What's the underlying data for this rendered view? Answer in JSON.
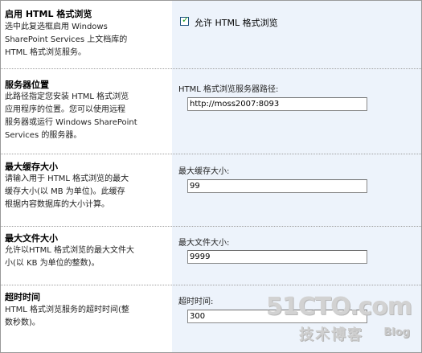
{
  "sections": [
    {
      "title": "启用 HTML 格式浏览",
      "desc": "选中此复选框启用 Windows\nSharePoint Services 上文档库的\nHTML 格式浏览服务。",
      "checkbox_label": "允许 HTML 格式浏览",
      "checked": true
    },
    {
      "title": "服务器位置",
      "desc": "此路径指定您安装 HTML 格式浏览\n应用程序的位置。您可以使用远程\n服务器或运行 Windows SharePoint\nServices 的服务器。",
      "field_label": "HTML 格式浏览服务器路径:",
      "value": "http://moss2007:8093"
    },
    {
      "title": "最大缓存大小",
      "desc": "请输入用于 HTML 格式浏览的最大\n缓存大小(以 MB 为单位)。此缓存\n根据内容数据库的大小计算。",
      "field_label": "最大缓存大小:",
      "value": "99"
    },
    {
      "title": "最大文件大小",
      "desc": "允许以HTML 格式浏览的最大文件大\n小(以 KB 为单位的整数)。",
      "field_label": "最大文件大小:",
      "value": "9999"
    },
    {
      "title": "超时时间",
      "desc": "HTML 格式浏览服务的超时时间(整\n数秒数)。",
      "field_label": "超时时间:",
      "value": "300"
    }
  ],
  "watermark": {
    "domain": "51CTO.com",
    "cn": "技术博客",
    "blog": "Blog"
  }
}
